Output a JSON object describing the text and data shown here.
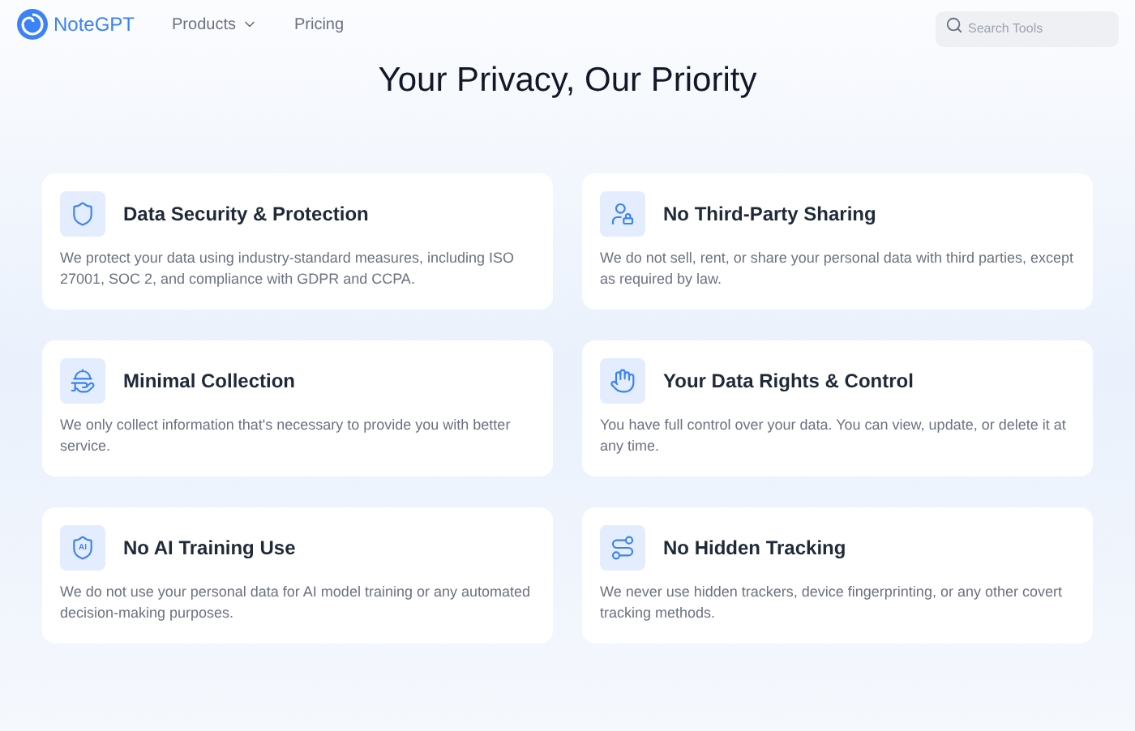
{
  "nav": {
    "brand": "NoteGPT",
    "links": [
      {
        "label": "Products",
        "has_menu": true
      },
      {
        "label": "Pricing",
        "has_menu": false
      }
    ],
    "search": {
      "placeholder": "Search Tools"
    }
  },
  "title": "Your Privacy, Our Priority",
  "cards": [
    {
      "kind": "security",
      "title": "Data Security & Protection",
      "text": "We protect your data using industry-standard measures, including ISO 27001, SOC 2, and compliance with GDPR and CCPA."
    },
    {
      "kind": "sharing",
      "title": "No Third-Party Sharing",
      "text": "We do not sell, rent, or share your personal data with third parties, except as required by law."
    },
    {
      "kind": "collection",
      "title": "Minimal Collection",
      "text": "We only collect information that's necessary to provide you with better service."
    },
    {
      "kind": "rights",
      "title": "Your Data Rights & Control",
      "text": "You have full control over your data. You can view, update, or delete it at any time."
    },
    {
      "kind": "ai",
      "title": "No AI Training Use",
      "icon_label": "AI",
      "text": "We do not use your personal data for AI model training or any automated decision-making purposes."
    },
    {
      "kind": "tracking",
      "title": "No Hidden Tracking",
      "text": "We never use hidden trackers, device fingerprinting, or any other covert tracking methods."
    }
  ]
}
